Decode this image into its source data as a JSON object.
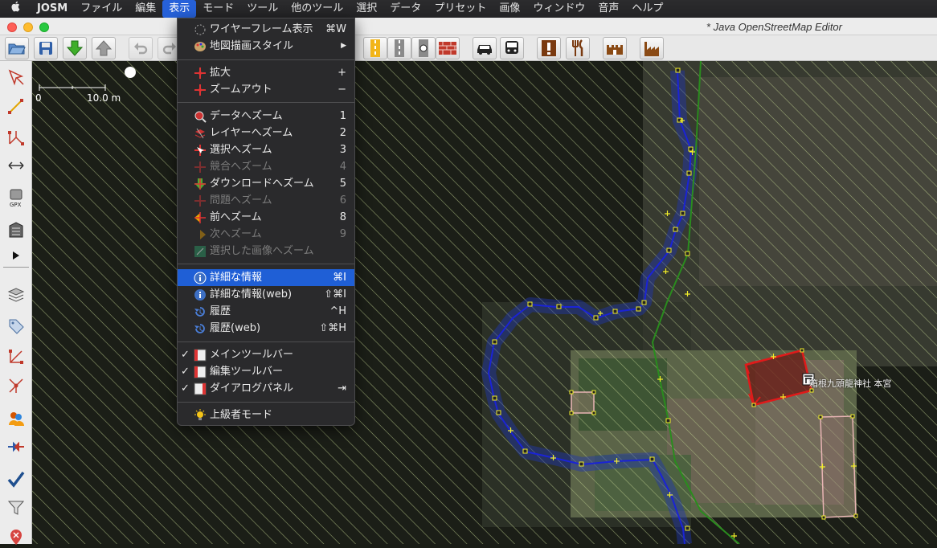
{
  "menubar": {
    "apple": "",
    "app": "JOSM",
    "items": [
      "ファイル",
      "編集",
      "表示",
      "モード",
      "ツール",
      "他のツール",
      "選択",
      "データ",
      "プリセット",
      "画像",
      "ウィンドウ",
      "音声",
      "ヘルプ"
    ]
  },
  "window": {
    "title": "* Java OpenStreetMap Editor"
  },
  "toolbar": {
    "icons": [
      "open-icon",
      "save-icon",
      "download-icon",
      "upload-icon",
      "undo-icon",
      "redo-icon",
      "lane-yellow-icon",
      "lane-gray-icon",
      "traffic-signal-icon",
      "wall-icon",
      "car-icon",
      "bus-icon",
      "warning-icon",
      "restaurant-icon",
      "castle-icon",
      "factory-icon"
    ]
  },
  "sidebar": {
    "icons": [
      "select-tool-icon",
      "draw-tool-icon",
      "improve-way-icon",
      "parallel-tool-icon",
      "gpx-icon",
      "building-tool-icon",
      "expand-icon",
      "layers-icon",
      "tags-icon",
      "relation-icon",
      "validator-icon",
      "authors-icon",
      "conflict-icon",
      "check-icon",
      "filter-icon",
      "notes-icon"
    ]
  },
  "view_menu": {
    "items": [
      {
        "label": "ワイヤーフレーム表示",
        "shortcut": "⌘W",
        "icon": "wireframe-icon",
        "state": "normal"
      },
      {
        "label": "地図描画スタイル",
        "shortcut": "▶",
        "icon": "palette-icon",
        "state": "normal"
      },
      {
        "label": "拡大",
        "shortcut": "+",
        "icon": "zoom-in-icon",
        "state": "normal"
      },
      {
        "label": "ズームアウト",
        "shortcut": "−",
        "icon": "zoom-out-icon",
        "state": "normal"
      },
      {
        "label": "データへズーム",
        "shortcut": "1",
        "icon": "zoom-data-icon",
        "state": "normal"
      },
      {
        "label": "レイヤーへズーム",
        "shortcut": "2",
        "icon": "zoom-layer-icon",
        "state": "normal"
      },
      {
        "label": "選択へズーム",
        "shortcut": "3",
        "icon": "zoom-selection-icon",
        "state": "normal"
      },
      {
        "label": "競合へズーム",
        "shortcut": "4",
        "icon": "zoom-conflict-icon",
        "state": "disabled"
      },
      {
        "label": "ダウンロードへズーム",
        "shortcut": "5",
        "icon": "zoom-download-icon",
        "state": "normal"
      },
      {
        "label": "問題へズーム",
        "shortcut": "6",
        "icon": "zoom-problem-icon",
        "state": "disabled"
      },
      {
        "label": "前へズーム",
        "shortcut": "8",
        "icon": "zoom-previous-icon",
        "state": "normal"
      },
      {
        "label": "次へズーム",
        "shortcut": "9",
        "icon": "zoom-next-icon",
        "state": "disabled"
      },
      {
        "label": "選択した画像へズーム",
        "shortcut": "",
        "icon": "zoom-image-icon",
        "state": "disabled"
      },
      {
        "label": "詳細な情報",
        "shortcut": "⌘I",
        "icon": "info-icon",
        "state": "highlighted"
      },
      {
        "label": "詳細な情報(web)",
        "shortcut": "⇧⌘I",
        "icon": "info-icon",
        "state": "normal"
      },
      {
        "label": "履歴",
        "shortcut": "^H",
        "icon": "history-icon",
        "state": "normal"
      },
      {
        "label": "履歴(web)",
        "shortcut": "⇧⌘H",
        "icon": "history-icon",
        "state": "normal"
      },
      {
        "label": "メインツールバー",
        "shortcut": "",
        "icon": "toolbar-icon",
        "state": "checked"
      },
      {
        "label": "編集ツールバー",
        "shortcut": "",
        "icon": "toolbar-icon",
        "state": "checked"
      },
      {
        "label": "ダイアログパネル",
        "shortcut": "⇥",
        "icon": "dialog-panel-icon",
        "state": "checked"
      },
      {
        "label": "上級者モード",
        "shortcut": "",
        "icon": "bulb-icon",
        "state": "normal"
      }
    ]
  },
  "map": {
    "scale_start": "0",
    "scale_end": "10.0 m",
    "poi_label": "箱根九頭龍神社 本宮",
    "colors": {
      "hatch": "#b8c98a",
      "boundary": "#1a23d6",
      "path": "#2a8c1e",
      "selected": "#e01a1a",
      "building": "#e8b4b4"
    }
  }
}
